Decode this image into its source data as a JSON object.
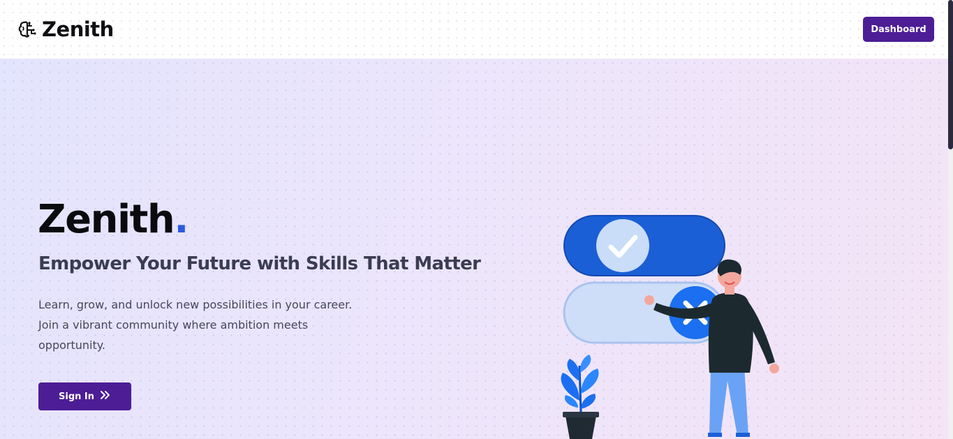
{
  "header": {
    "brand_name": "Zenith",
    "brand_icon": "brain-icon",
    "dashboard_label": "Dashboard"
  },
  "hero": {
    "title": "Zenith",
    "title_dot": ".",
    "subtitle": "Empower Your Future with Skills That Matter",
    "description_lines": [
      "Learn, grow, and unlock new possibilities in your career.",
      "Join a vibrant community where ambition meets",
      "opportunity."
    ],
    "signin_label": "Sign In",
    "signin_icon": "double-chevron-right-icon",
    "illustration": "person-with-toggles-illustration"
  },
  "colors": {
    "primary": "#4c1d95",
    "accent_blue": "#2b5be0",
    "toggle_blue": "#1b5fd6",
    "hero_bg_start": "#e3e4fd",
    "hero_bg_end": "#f4e4f6"
  }
}
